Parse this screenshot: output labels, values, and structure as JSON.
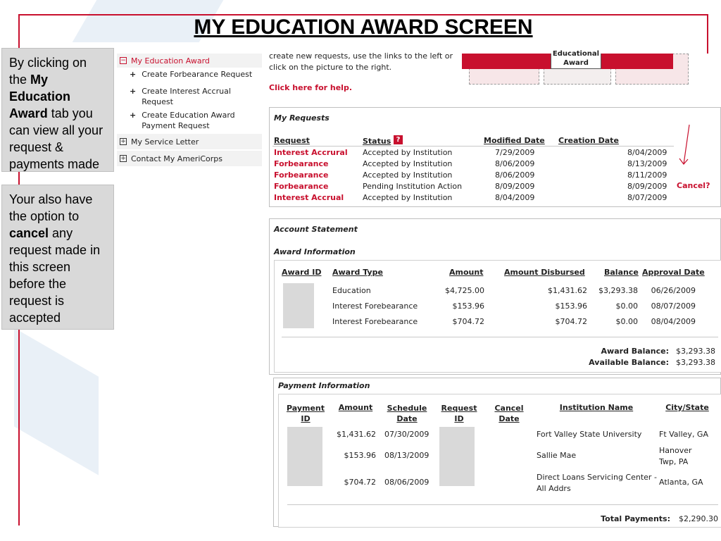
{
  "slide": {
    "title": "MY EDUCATION AWARD SCREEN",
    "note1": {
      "pre": "By clicking on the ",
      "bold": "My Education Award",
      "post": " tab you can view all your request & payments made"
    },
    "note2": {
      "pre": "Your also have the option to ",
      "bold": "cancel",
      "post": " any request made in this screen before the request is accepted"
    }
  },
  "nav": {
    "top": {
      "label": "My Education Award",
      "icon": "minus-box-icon"
    },
    "subitems": [
      {
        "label": "Create Forbearance Request"
      },
      {
        "label": "Create Interest Accrual Request"
      },
      {
        "label": "Create Education Award Payment Request"
      }
    ],
    "sections": [
      {
        "label": "My Service Letter",
        "icon": "plus-box-icon"
      },
      {
        "label": "Contact My AmeriCorps",
        "icon": "plus-box-icon"
      }
    ]
  },
  "intro": {
    "text": "create new requests, use the links to the left or click on the picture to the right.",
    "help": "Click here for help."
  },
  "picture": {
    "label": "Educational Award"
  },
  "my_requests": {
    "title": "My Requests",
    "headers": [
      "Request",
      "Status",
      "Modified Date",
      "Creation Date"
    ],
    "status_icon": "help-icon",
    "rows": [
      {
        "request": "Interest Accrural",
        "status": "Accepted by Institution",
        "modified": "7/29/2009",
        "created": "8/04/2009"
      },
      {
        "request": "Forbearance",
        "status": "Accepted by Institution",
        "modified": "8/06/2009",
        "created": "8/13/2009"
      },
      {
        "request": "Forbearance",
        "status": "Accepted by Institution",
        "modified": "8/06/2009",
        "created": "8/11/2009"
      },
      {
        "request": "Forbearance",
        "status": "Pending Institution Action",
        "modified": "8/09/2009",
        "created": "8/09/2009"
      },
      {
        "request": "Interest Accrual",
        "status": "Accepted by Institution",
        "modified": "8/04/2009",
        "created": "8/07/2009"
      }
    ],
    "cancel_label": "Cancel?"
  },
  "account": {
    "title": "Account Statement",
    "award_title": "Award Information",
    "award_headers": [
      "Award ID",
      "Award Type",
      "Amount",
      "Amount Disbursed",
      "Balance",
      "Approval Date"
    ],
    "award_rows": [
      {
        "type": "Education",
        "amount": "$4,725.00",
        "disbursed": "$1,431.62",
        "balance": "$3,293.38",
        "date": "06/26/2009"
      },
      {
        "type": "Interest Forebearance",
        "amount": "$153.96",
        "disbursed": "$153.96",
        "balance": "$0.00",
        "date": "08/07/2009"
      },
      {
        "type": "Interest Forebearance",
        "amount": "$704.72",
        "disbursed": "$704.72",
        "balance": "$0.00",
        "date": "08/04/2009"
      }
    ],
    "award_balance_label": "Award Balance:",
    "award_balance": "$3,293.38",
    "available_balance_label": "Available Balance:",
    "available_balance": "$3,293.38"
  },
  "payment": {
    "title": "Payment Information",
    "headers": [
      "Payment ID",
      "Amount",
      "Schedule Date",
      "Request ID",
      "Cancel Date",
      "Institution Name",
      "City/State"
    ],
    "rows": [
      {
        "amount": "$1,431.62",
        "date": "07/30/2009",
        "institution": "Fort Valley State University",
        "city": "Ft Valley, GA"
      },
      {
        "amount": "$153.96",
        "date": "08/13/2009",
        "institution": "Sallie Mae",
        "city": "Hanover Twp, PA"
      },
      {
        "amount": "$704.72",
        "date": "08/06/2009",
        "institution": "Direct Loans Servicing Center -All Addrs",
        "city": "Atlanta, GA"
      }
    ],
    "total_label": "Total Payments:",
    "total": "$2,290.30"
  },
  "colors": {
    "accent": "#c8102e",
    "note_bg": "#d9d9d9",
    "bg_shape": "#dfe9f4"
  }
}
